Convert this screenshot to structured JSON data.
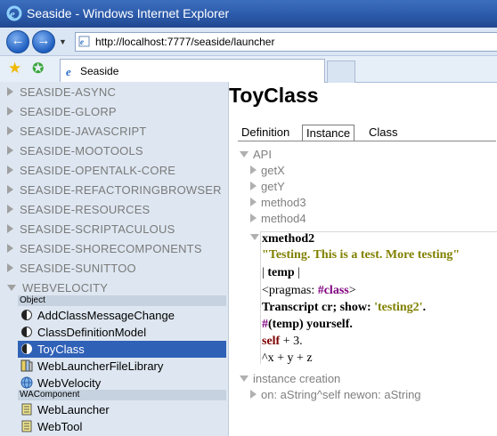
{
  "window": {
    "title": "Seaside - Windows Internet Explorer"
  },
  "address": {
    "url": "http://localhost:7777/seaside/launcher"
  },
  "browser_tab": {
    "label": "Seaside"
  },
  "packages": [
    "SEASIDE-ASYNC",
    "SEASIDE-GLORP",
    "SEASIDE-JAVASCRIPT",
    "SEASIDE-MOOTOOLS",
    "SEASIDE-OPENTALK-CORE",
    "SEASIDE-REFACTORINGBROWSER",
    "SEASIDE-RESOURCES",
    "SEASIDE-SCRIPTACULOUS",
    "SEASIDE-SHORECOMPONENTS",
    "SEASIDE-SUNITTOO",
    "WEBVELOCITY"
  ],
  "categories": {
    "object": "Object",
    "wacomponent": "WAComponent"
  },
  "classes": [
    "AddClassMessageChange",
    "ClassDefinitionModel",
    "ToyClass",
    "WebLauncherFileLibrary",
    "WebVelocity",
    "WebLauncher",
    "WebTool"
  ],
  "content": {
    "class_title": "ToyClass",
    "tabs": [
      "Definition",
      "Instance",
      "Class"
    ],
    "protocol_api": "API",
    "methods": [
      "getX",
      "getY",
      "method3",
      "method4",
      "xmethod2"
    ],
    "protocol_instance_creation": "instance creation",
    "creation_method": "on: aString^self newon: aString",
    "code": {
      "line1": "\"Testing. This is a test. More testing\"",
      "line2a": "| ",
      "line2b": "temp",
      "line2c": " |",
      "line3a": "<pragmas: ",
      "line3b": "#class",
      "line3c": ">",
      "line4a": "Transcript cr; show: ",
      "line4b": "'testing2'",
      "line4c": ".",
      "line5a": "#",
      "line5b": "(temp) yourself.",
      "line6a": "self",
      "line6b": " + 3.",
      "line7": "^x + y + z"
    }
  },
  "colors": {
    "selection": "#2f61b7",
    "sidebar_bg": "#dee7f1",
    "string": "#808000",
    "keyword": "#7f007f"
  }
}
